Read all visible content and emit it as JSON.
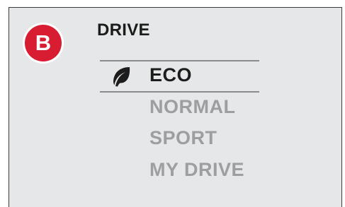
{
  "badge": {
    "letter": "B",
    "color": "#d81c32"
  },
  "screen": {
    "title": "DRIVE"
  },
  "menu": {
    "items": [
      {
        "label": "ECO",
        "selected": true,
        "icon": "leaf-icon"
      },
      {
        "label": "NORMAL",
        "selected": false
      },
      {
        "label": "SPORT",
        "selected": false
      },
      {
        "label": "MY DRIVE",
        "selected": false
      }
    ]
  },
  "colors": {
    "background": "#e6e7e8",
    "selected_text": "#1c1c1c",
    "dim_text": "#9d9e9f",
    "divider": "#8a8b8c"
  }
}
